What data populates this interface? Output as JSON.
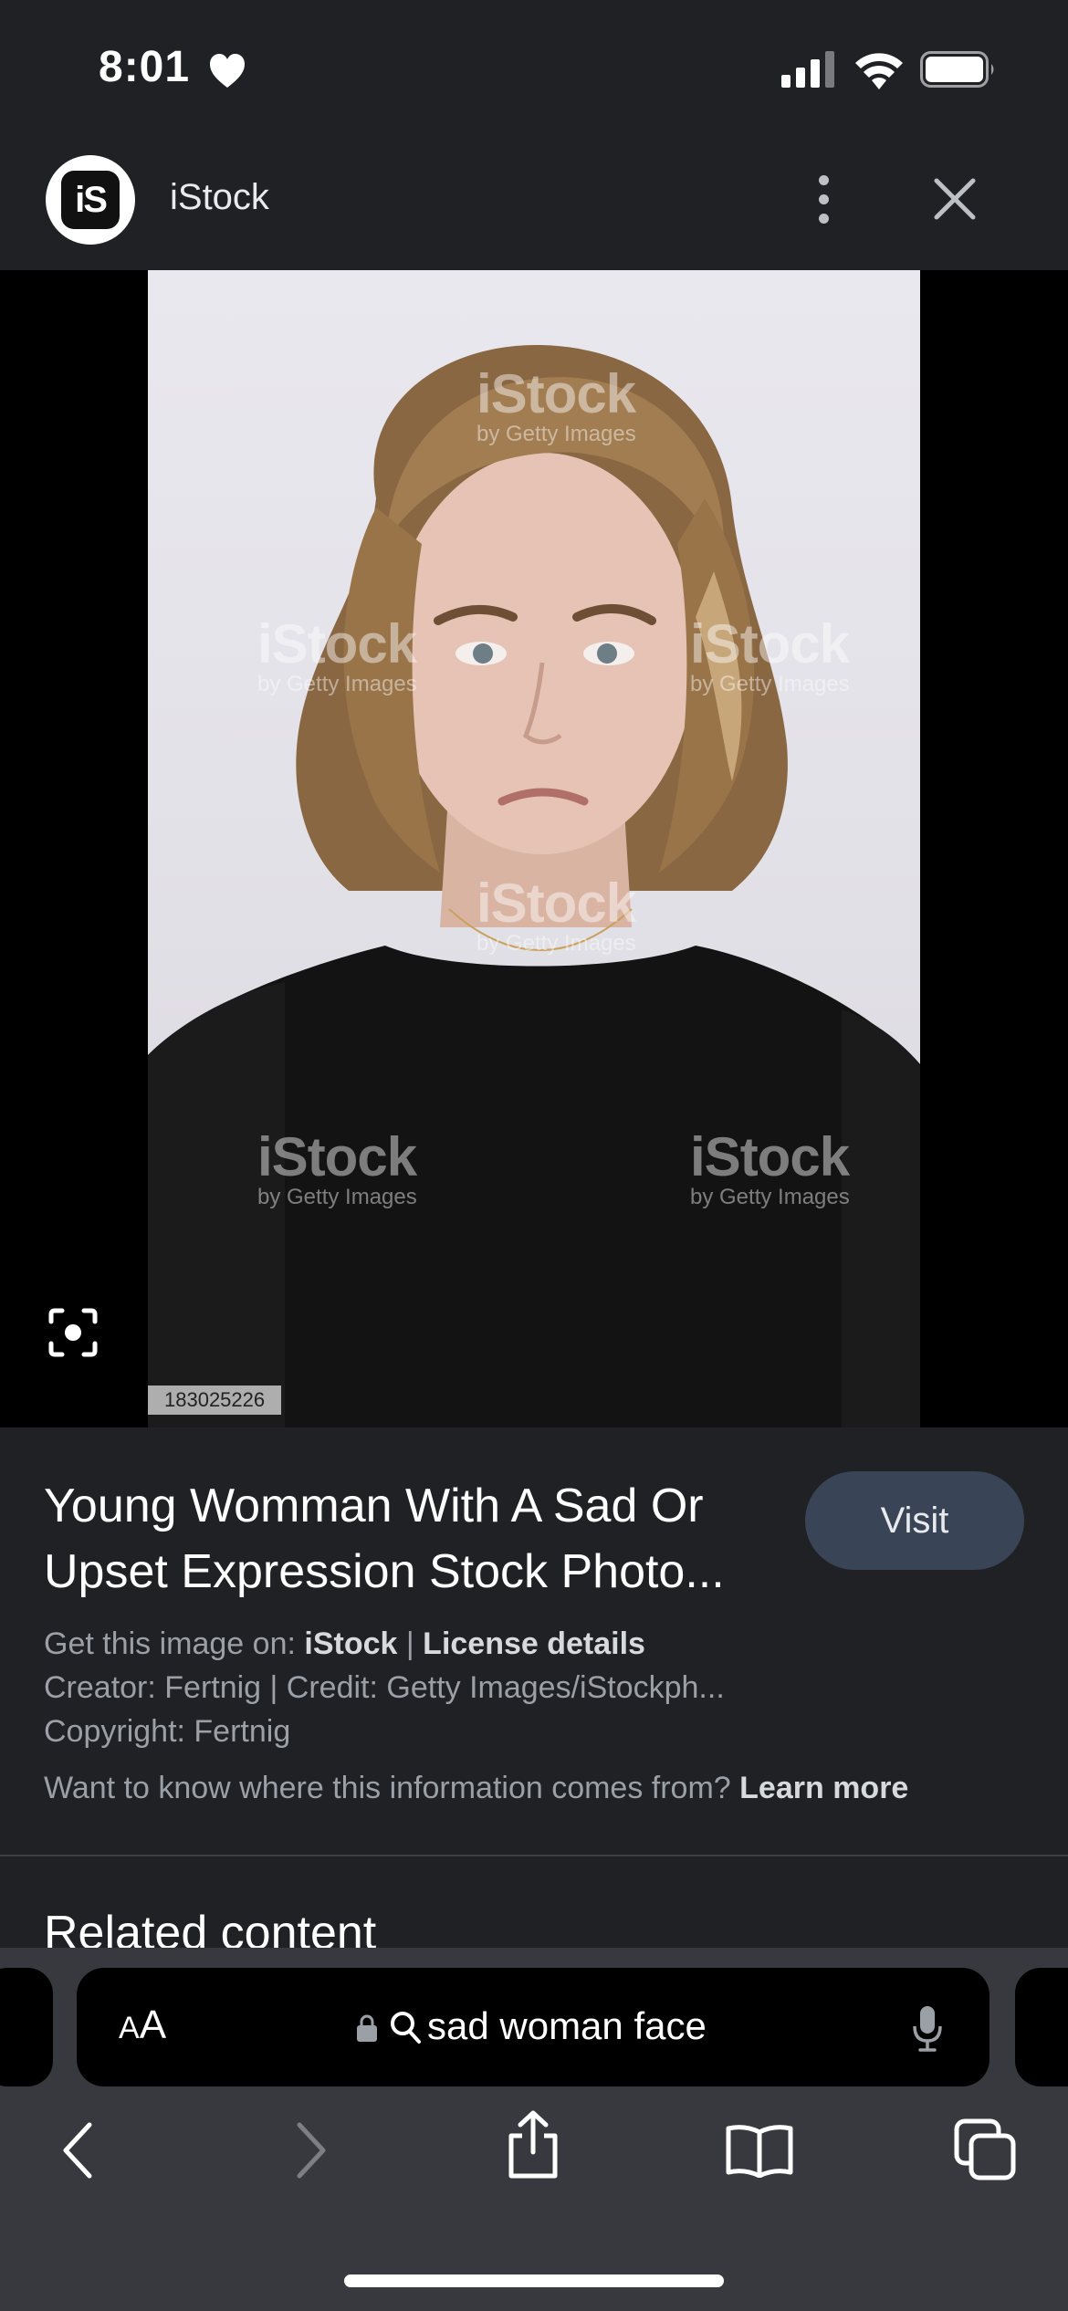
{
  "status_bar": {
    "time": "8:01"
  },
  "source": {
    "logo_text": "iS",
    "name": "iStock"
  },
  "image": {
    "watermark_brand": "iStock",
    "watermark_sub": "by Getty Images",
    "photo_id": "183025226"
  },
  "result": {
    "title": "Young Womman With A Sad Or Upset Expression Stock Photo...",
    "visit_label": "Visit",
    "get_image_prefix": "Get this image on:",
    "get_image_source": "iStock",
    "separator": "|",
    "license_label": "License details",
    "creator_line": "Creator: Fertnig | Credit: Getty Images/iStockph...",
    "copyright_line": "Copyright: Fertnig",
    "info_question": "Want to know where this information comes from?",
    "learn_more": "Learn more"
  },
  "related_heading": "Related content",
  "safari": {
    "aa_small": "A",
    "aa_large": "A",
    "address": "sad woman face"
  },
  "icons": {
    "status": [
      "heart-icon",
      "cellular-signal-icon",
      "wifi-icon",
      "battery-icon"
    ],
    "toolbar": [
      "back-icon",
      "forward-icon",
      "share-icon",
      "bookmarks-icon",
      "tabs-icon"
    ]
  }
}
